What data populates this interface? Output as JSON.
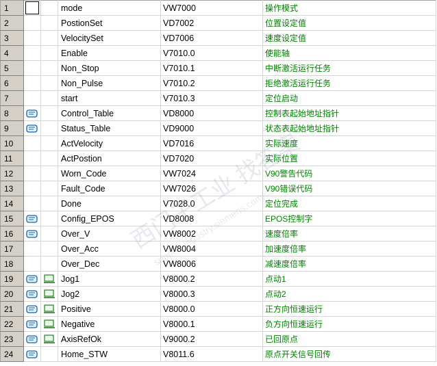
{
  "rows": [
    {
      "num": "1",
      "name": "mode",
      "addr": "VW7000",
      "comment": "操作模式",
      "icons": []
    },
    {
      "num": "2",
      "name": "PostionSet",
      "addr": "VD7002",
      "comment": "位置设定值",
      "icons": []
    },
    {
      "num": "3",
      "name": "VelocitySet",
      "addr": "VD7006",
      "comment": "速度设定值",
      "icons": []
    },
    {
      "num": "4",
      "name": "Enable",
      "addr": "V7010.0",
      "comment": "使能轴",
      "icons": []
    },
    {
      "num": "5",
      "name": "Non_Stop",
      "addr": "V7010.1",
      "comment": "中断激活运行任务",
      "icons": []
    },
    {
      "num": "6",
      "name": "Non_Pulse",
      "addr": "V7010.2",
      "comment": "拒绝激活运行任务",
      "icons": []
    },
    {
      "num": "7",
      "name": "start",
      "addr": "V7010.3",
      "comment": "定位启动",
      "icons": []
    },
    {
      "num": "8",
      "name": "Control_Table",
      "addr": "VD8000",
      "comment": "控制表起始地址指针",
      "icons": [
        "symbol-icon"
      ]
    },
    {
      "num": "9",
      "name": "Status_Table",
      "addr": "VD9000",
      "comment": "状态表起始地址指针",
      "icons": [
        "symbol-icon"
      ]
    },
    {
      "num": "10",
      "name": "ActVelocity",
      "addr": "VD7016",
      "comment": "实际速度",
      "icons": []
    },
    {
      "num": "11",
      "name": "ActPostion",
      "addr": "VD7020",
      "comment": "实际位置",
      "icons": []
    },
    {
      "num": "12",
      "name": "Worn_Code",
      "addr": "VW7024",
      "comment": "V90警告代码",
      "icons": []
    },
    {
      "num": "13",
      "name": "Fault_Code",
      "addr": "VW7026",
      "comment": "V90错误代码",
      "icons": []
    },
    {
      "num": "14",
      "name": "Done",
      "addr": "V7028.0",
      "comment": "定位完成",
      "icons": []
    },
    {
      "num": "15",
      "name": "Config_EPOS",
      "addr": "VD8008",
      "comment": "EPOS控制字",
      "icons": [
        "symbol-icon"
      ]
    },
    {
      "num": "16",
      "name": "Over_V",
      "addr": "VW8002",
      "comment": "速度倍率",
      "icons": [
        "symbol-icon"
      ]
    },
    {
      "num": "17",
      "name": "Over_Acc",
      "addr": "VW8004",
      "comment": "加速度倍率",
      "icons": []
    },
    {
      "num": "18",
      "name": "Over_Dec",
      "addr": "VW8006",
      "comment": "减速度倍率",
      "icons": []
    },
    {
      "num": "19",
      "name": "Jog1",
      "addr": "V8000.2",
      "comment": "点动1",
      "icons": [
        "symbol-icon",
        "hmi-icon"
      ]
    },
    {
      "num": "20",
      "name": "Jog2",
      "addr": "V8000.3",
      "comment": "点动2",
      "icons": [
        "symbol-icon",
        "hmi-icon"
      ]
    },
    {
      "num": "21",
      "name": "Positive",
      "addr": "V8000.0",
      "comment": "正方向恒速运行",
      "icons": [
        "symbol-icon",
        "hmi-icon"
      ]
    },
    {
      "num": "22",
      "name": "Negative",
      "addr": "V8000.1",
      "comment": "负方向恒速运行",
      "icons": [
        "symbol-icon",
        "hmi-icon"
      ]
    },
    {
      "num": "23",
      "name": "AxisRefOk",
      "addr": "V9000.2",
      "comment": "已回原点",
      "icons": [
        "symbol-icon",
        "hmi-icon"
      ]
    },
    {
      "num": "24",
      "name": "Home_STW",
      "addr": "V8011.6",
      "comment": "原点开关信号回传",
      "icons": [
        "symbol-icon"
      ]
    }
  ],
  "colors": {
    "comment_text": "#008000",
    "grid": "#d4d4d4",
    "header_bg": "#d4d0c8"
  },
  "watermark": {
    "line1": "西门子工业 找答案",
    "line2": "support.industry.siemens.com/cs"
  }
}
